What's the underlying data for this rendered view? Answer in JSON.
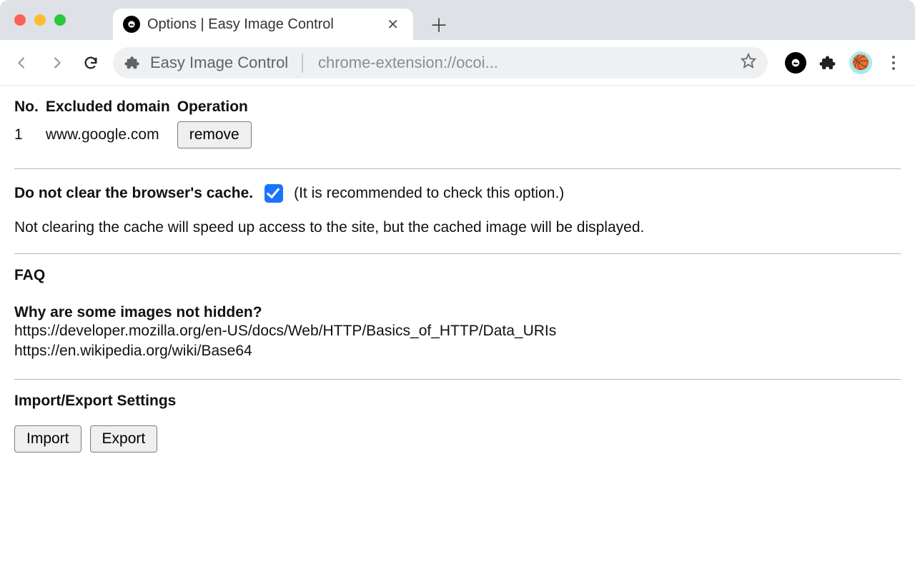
{
  "browser": {
    "tab_title": "Options | Easy Image Control",
    "omnibox_name": "Easy Image Control",
    "omnibox_url": "chrome-extension://ocoi..."
  },
  "table": {
    "headers": {
      "no": "No.",
      "domain": "Excluded domain",
      "op": "Operation"
    },
    "rows": [
      {
        "no": "1",
        "domain": "www.google.com",
        "remove_label": "remove"
      }
    ]
  },
  "cache": {
    "label": "Do not clear the browser's cache.",
    "checked": true,
    "hint": "(It is recommended to check this option.)",
    "note": "Not clearing the cache will speed up access to the site, but the cached image will be displayed."
  },
  "faq": {
    "heading": "FAQ",
    "question": "Why are some images not hidden?",
    "links": [
      "https://developer.mozilla.org/en-US/docs/Web/HTTP/Basics_of_HTTP/Data_URIs",
      "https://en.wikipedia.org/wiki/Base64"
    ]
  },
  "io": {
    "heading": "Import/Export Settings",
    "import_label": "Import",
    "export_label": "Export"
  }
}
